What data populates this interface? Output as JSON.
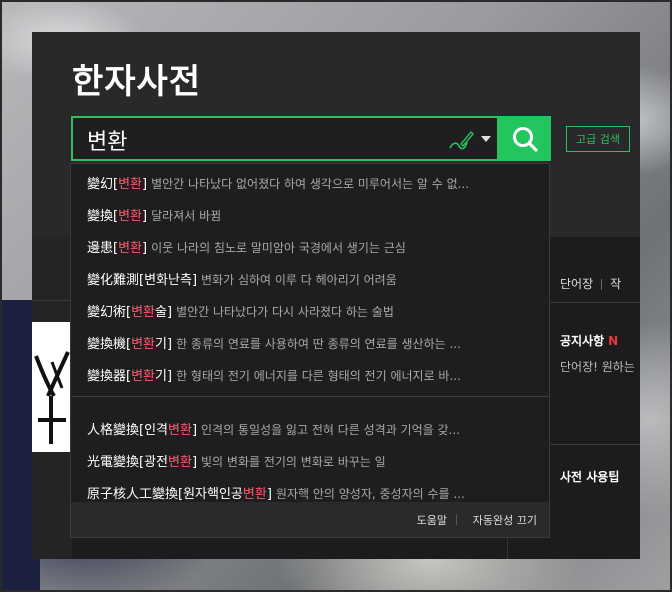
{
  "app": {
    "title": "한자사전",
    "advanced_search_label": "고급 검색"
  },
  "search": {
    "value": "변환",
    "placeholder": "",
    "icons": {
      "handwriting": "handwriting-input-icon",
      "dropdown": "chevron-down-icon",
      "search": "search-icon"
    }
  },
  "suggestions": [
    {
      "hanja": "變幻",
      "k1": "",
      "hl": "변환",
      "k2": "",
      "def": "별안간 나타났다 없어졌다 하여 생각으로 미루어서는 알 수 없..."
    },
    {
      "hanja": "變換",
      "k1": "",
      "hl": "변환",
      "k2": "",
      "def": "달라져서 바뀜"
    },
    {
      "hanja": "邊患",
      "k1": "",
      "hl": "변환",
      "k2": "",
      "def": "이웃 나라의 침노로 말미암아 국경에서 생기는 근심"
    },
    {
      "hanja": "變化難測",
      "k1": "변화난측",
      "hl": "",
      "k2": "",
      "def": "변화가 심하여 이루 다 헤아리기 어려움"
    },
    {
      "hanja": "變幻術",
      "k1": "",
      "hl": "변환",
      "k2": "술",
      "def": "별안간 나타났다가 다시 사라졌다 하는 술법"
    },
    {
      "hanja": "變換機",
      "k1": "",
      "hl": "변환",
      "k2": "기",
      "def": "한 종류의 연료를 사용하여 딴 종류의 연료를 생산하는 ..."
    },
    {
      "hanja": "變換器",
      "k1": "",
      "hl": "변환",
      "k2": "기",
      "def": "한 형태의 전기 에너지를 다른 형태의 전기 에너지로 바..."
    },
    {
      "hanja": "人格變換",
      "k1": "인격",
      "hl": "변환",
      "k2": "",
      "def": "인격의 통일성을 잃고 전혀 다른 성격과 기억을 갖..."
    },
    {
      "hanja": "光電變換",
      "k1": "광전",
      "hl": "변환",
      "k2": "",
      "def": "빛의 변화를 전기의 변화로 바꾸는 일"
    },
    {
      "hanja": "原子核人工變換",
      "k1": "원자핵인공",
      "hl": "변환",
      "k2": "",
      "def": "원자핵 안의 양성자, 중성자의 수를 ..."
    }
  ],
  "dropdown_footer": {
    "help": "도움말",
    "autocomplete_off": "자동완성 끄기"
  },
  "side": {
    "tabs": [
      "단어장",
      "작"
    ],
    "notice_title": "공지사항",
    "notice_badge": "N",
    "notice_text": "단어장! 원하는",
    "tips_title": "사전 사용팁"
  },
  "colors": {
    "accent": "#22c55e",
    "highlight": "#ff5a6b",
    "panel": "#29292b"
  }
}
